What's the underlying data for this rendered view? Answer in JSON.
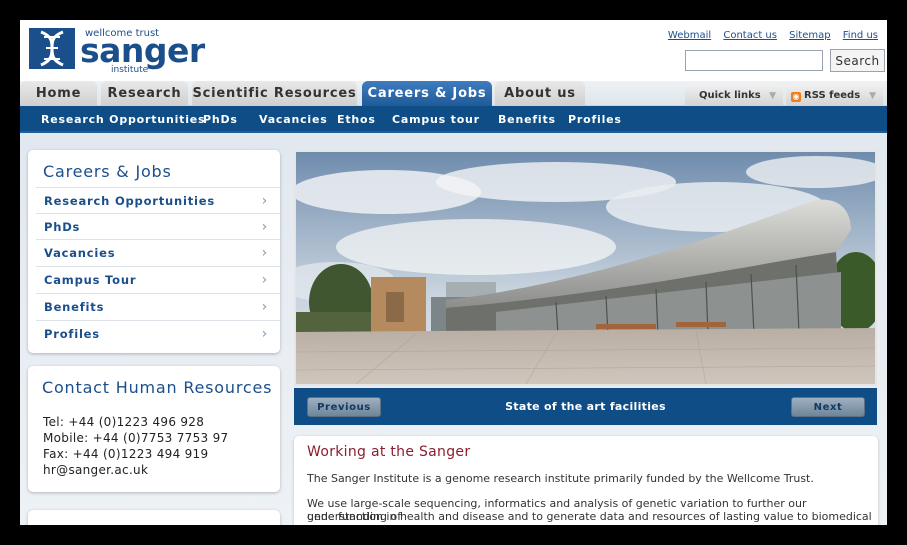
{
  "logo": {
    "small": "wellcome trust",
    "big": "sanger",
    "institute": "institute"
  },
  "utility_links": [
    "Webmail",
    "Contact us",
    "Sitemap",
    "Find us"
  ],
  "search": {
    "placeholder": "",
    "button": "Search"
  },
  "main_tabs": [
    {
      "label": "Home",
      "active": false
    },
    {
      "label": "Research",
      "active": false
    },
    {
      "label": "Scientific Resources",
      "active": false
    },
    {
      "label": "Careers & Jobs",
      "active": true
    },
    {
      "label": "About us",
      "active": false
    }
  ],
  "quick_links": "Quick links",
  "rss_feeds": "RSS feeds",
  "subnav": [
    "Research Opportunities",
    "PhDs",
    "Vacancies",
    "Ethos",
    "Campus tour",
    "Benefits",
    "Profiles"
  ],
  "sidebar": {
    "title": "Careers & Jobs",
    "items": [
      "Research Opportunities",
      "PhDs",
      "Vacancies",
      "Campus Tour",
      "Benefits",
      "Profiles"
    ]
  },
  "contact": {
    "title": "Contact Human Resources",
    "tel": "Tel: +44 (0)1223 496 928",
    "mobile": "Mobile: +44 (0)7753 7753 97",
    "fax": "Fax: +44 (0)1223 494 919",
    "email": "hr@sanger.ac.uk"
  },
  "slideshow": {
    "previous": "Previous",
    "caption": "State of the art facilities",
    "next": "Next"
  },
  "intro": {
    "title": "Working at the Sanger",
    "p1": "The Sanger Institute is a genome research institute primarily funded by the Wellcome Trust.",
    "p2a": "We use large-scale sequencing, informatics and analysis of genetic variation to further our understanding of",
    "p2b": "gene function in health and disease and to generate data and resources of lasting value to biomedical research."
  },
  "colors": {
    "brand_blue": "#0e4d86",
    "active_tab": "#2b6aab",
    "heading_red": "#8b1e2d"
  }
}
